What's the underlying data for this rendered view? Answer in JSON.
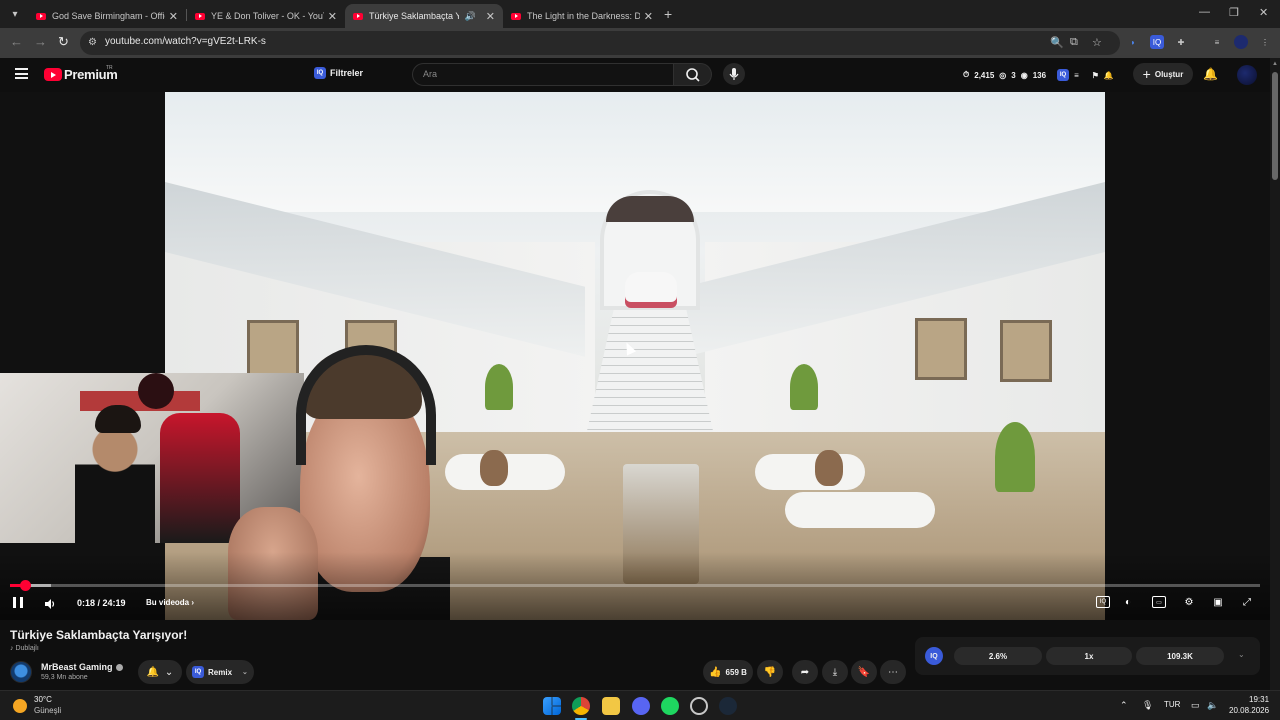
{
  "browser": {
    "tabs": [
      {
        "title": "God Save Birmingham - Official",
        "active": false
      },
      {
        "title": "YE & Don Toliver - OK - YouTube",
        "active": false
      },
      {
        "title": "Türkiye Saklambaçta Yarışıyo",
        "active": true
      },
      {
        "title": "The Light in the Darkness: Direc",
        "active": false
      }
    ],
    "new_tab_icon": "plus-icon",
    "url": "youtube.com/watch?v=gVE2t-LRK-s"
  },
  "youtube": {
    "brand": "Premium",
    "region": "TR",
    "filter_label": "Filtreler",
    "filter_badge": "IQ",
    "search_placeholder": "Ara",
    "stats": {
      "count1": "2,415",
      "count2": "3",
      "count3": "136"
    },
    "create_label": "Oluştur"
  },
  "player": {
    "timecode": "0:18 / 24:19",
    "chapter_label": "Bu videoda",
    "progress": 0.012,
    "buffered": 0.033
  },
  "video": {
    "title": "Türkiye Saklambaçta Yarışıyor!",
    "dub_label": "Dublajlı",
    "channel_name": "MrBeast Gaming",
    "subscribers": "59,3 Mn abone",
    "remix_label": "Remix",
    "like_count": "659 B"
  },
  "iq_panel": {
    "logo": "IQ",
    "value1": "2.6%",
    "value2": "1x",
    "value3": "109.3K"
  },
  "taskbar": {
    "temperature": "30°C",
    "condition": "Güneşli",
    "language": "TUR",
    "time": "19:31",
    "date": "20.08.2026"
  },
  "colors": {
    "accent": "#ff0033",
    "background": "#0f0f0f",
    "taskbar_active": "#4cc2ff"
  }
}
